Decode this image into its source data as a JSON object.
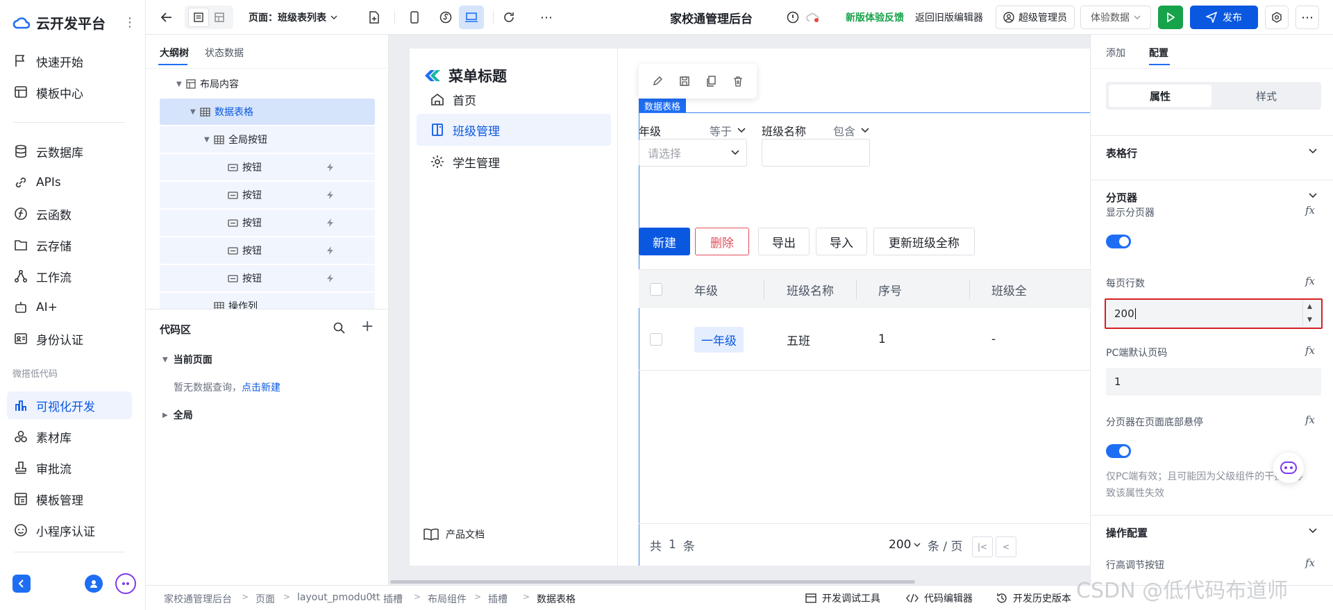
{
  "app": {
    "brand_name": "云开发平台"
  },
  "left_nav": {
    "items": [
      {
        "label": "快速开始",
        "icon": "flag-icon"
      },
      {
        "label": "模板中心",
        "icon": "template-icon"
      },
      {
        "label": "云数据库",
        "icon": "database-icon"
      },
      {
        "label": "APIs",
        "icon": "link-icon"
      },
      {
        "label": "云函数",
        "icon": "function-icon"
      },
      {
        "label": "云存储",
        "icon": "folder-icon"
      },
      {
        "label": "工作流",
        "icon": "workflow-icon"
      },
      {
        "label": "AI+",
        "icon": "robot-icon"
      },
      {
        "label": "身份认证",
        "icon": "id-card-icon"
      }
    ],
    "group_label": "微搭低代码",
    "lowcode_items": [
      {
        "label": "可视化开发",
        "icon": "visual-dev-icon",
        "active": true
      },
      {
        "label": "素材库",
        "icon": "assets-icon"
      },
      {
        "label": "审批流",
        "icon": "stamp-icon"
      },
      {
        "label": "模板管理",
        "icon": "template-manage-icon"
      },
      {
        "label": "小程序认证",
        "icon": "miniprogram-icon"
      }
    ]
  },
  "toolbar": {
    "page_label": "页面：班级表列表",
    "app_title": "家校通管理后台",
    "feedback_link": "新版体验反馈",
    "old_editor_link": "返回旧版编辑器",
    "user_label": "超级管理员",
    "data_env_label": "体验数据",
    "publish_label": "发布"
  },
  "tree": {
    "tabs": [
      "大纲树",
      "状态数据"
    ],
    "nodes": [
      {
        "label": "布局内容",
        "indent": 1,
        "arrow": "▼",
        "type": "layout"
      },
      {
        "label": "数据表格",
        "indent": 2,
        "arrow": "▼",
        "type": "table",
        "selected": true
      },
      {
        "label": "全局按钮",
        "indent": 3,
        "arrow": "▼",
        "type": "table"
      },
      {
        "label": "按钮",
        "indent": 4,
        "type": "button",
        "bolt": true
      },
      {
        "label": "按钮",
        "indent": 4,
        "type": "button",
        "bolt": true
      },
      {
        "label": "按钮",
        "indent": 4,
        "type": "button",
        "bolt": true
      },
      {
        "label": "按钮",
        "indent": 4,
        "type": "button",
        "bolt": true
      },
      {
        "label": "按钮",
        "indent": 4,
        "type": "button",
        "bolt": true
      },
      {
        "label": "操作列",
        "indent": 3,
        "type": "table"
      }
    ]
  },
  "code_area": {
    "title": "代码区",
    "current_page": "当前页面",
    "empty_text": "暂无数据查询，",
    "create_link": "点击新建",
    "global": "全局"
  },
  "preview": {
    "menu_title": "菜单标题",
    "menu": [
      {
        "label": "首页",
        "icon": "home-icon"
      },
      {
        "label": "班级管理",
        "icon": "book-icon",
        "active": true
      },
      {
        "label": "学生管理",
        "icon": "gear-icon"
      }
    ],
    "doc_link": "产品文档",
    "selection_tag": "数据表格",
    "filters": {
      "grade_label": "年级",
      "grade_op": "等于",
      "grade_placeholder": "请选择",
      "class_label": "班级名称",
      "class_op": "包含"
    },
    "actions": [
      "新建",
      "删除",
      "导出",
      "导入",
      "更新班级全称"
    ],
    "columns": [
      "年级",
      "班级名称",
      "序号",
      "班级全"
    ],
    "rows": [
      {
        "grade": "一年级",
        "class_name": "五班",
        "index": "1",
        "fullname": "-"
      }
    ],
    "pager": {
      "total_prefix": "共",
      "total": "1",
      "total_suffix": "条",
      "page_size": "200",
      "per_page": "条 / 页"
    }
  },
  "right_panel": {
    "tabs": [
      "添加",
      "配置"
    ],
    "segments": [
      "属性",
      "样式"
    ],
    "sections": {
      "table_row": "表格行",
      "pager": "分页器",
      "operation": "操作配置"
    },
    "props": {
      "show_pager": "显示分页器",
      "show_pager_on": true,
      "rows_per_page": "每页行数",
      "rows_per_page_value": "200",
      "pc_default_page": "PC端默认页码",
      "pc_default_page_value": "1",
      "pager_sticky": "分页器在页面底部悬停",
      "pager_sticky_on": true,
      "pager_hint": "仅PC端有效；且可能因为父级组件的干扰，导致该属性失效",
      "row_height_btn": "行高调节按钮"
    }
  },
  "statusbar": {
    "breadcrumbs": [
      "家校通管理后台",
      "页面",
      "layout_pmodu0tt",
      "插槽",
      "布局组件",
      "插槽",
      "数据表格"
    ],
    "tools": [
      "开发调试工具",
      "代码编辑器",
      "开发历史版本"
    ]
  },
  "watermark": "CSDN @低代码布道师"
}
